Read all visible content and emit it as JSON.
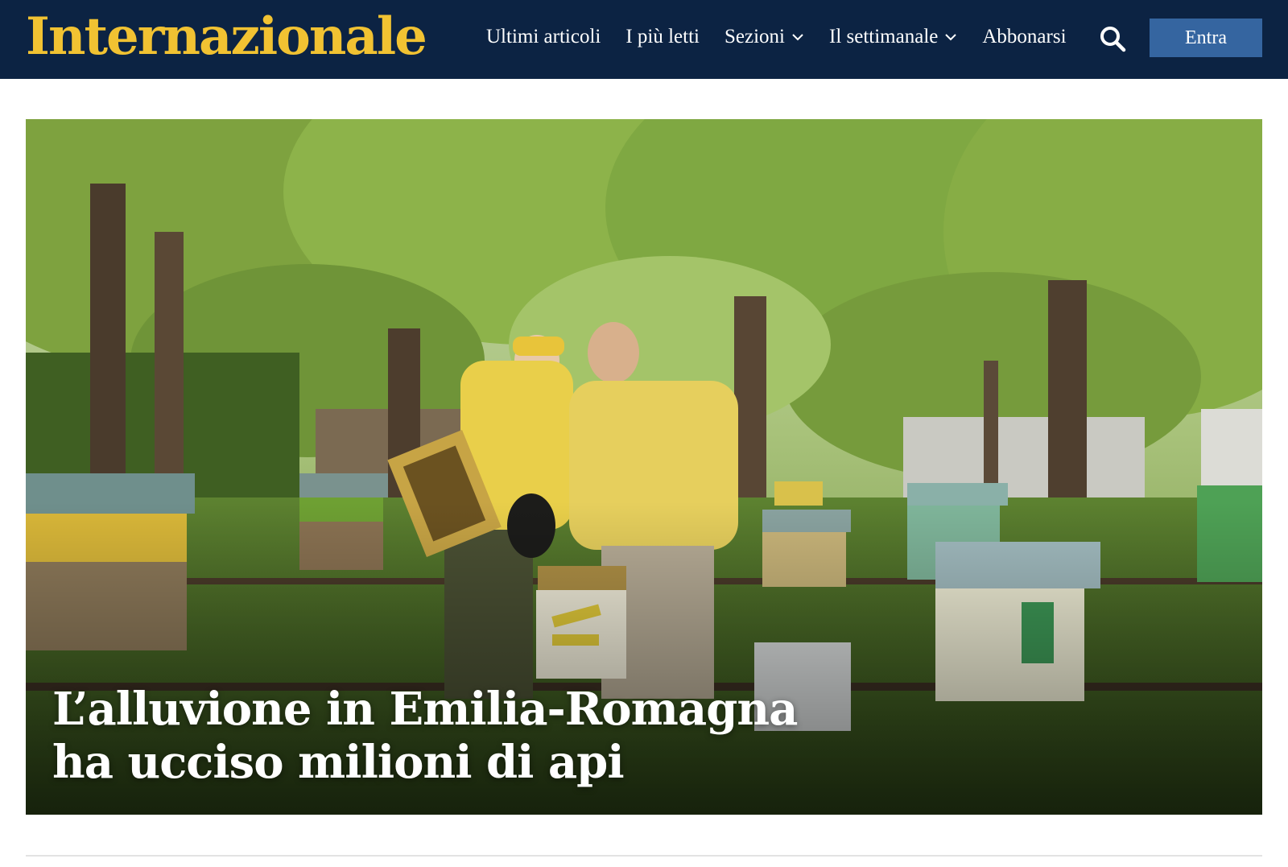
{
  "site": {
    "logo_text": "Internazionale",
    "brand_color": "#f1c232",
    "header_bg": "#0c2343"
  },
  "nav": {
    "items": [
      {
        "label": "Ultimi articoli",
        "has_dropdown": false
      },
      {
        "label": "I più letti",
        "has_dropdown": false
      },
      {
        "label": "Sezioni",
        "has_dropdown": true
      },
      {
        "label": "Il settimanale",
        "has_dropdown": true
      },
      {
        "label": "Abbonarsi",
        "has_dropdown": false
      }
    ],
    "search_icon": "search-icon",
    "login_label": "Entra",
    "login_color": "#3565a0"
  },
  "hero": {
    "image_subject": "beekeepers-inspecting-hives-photo",
    "headline_line1": "L’alluvione in Emilia-Romagna",
    "headline_line2": "ha ucciso milioni di api"
  }
}
